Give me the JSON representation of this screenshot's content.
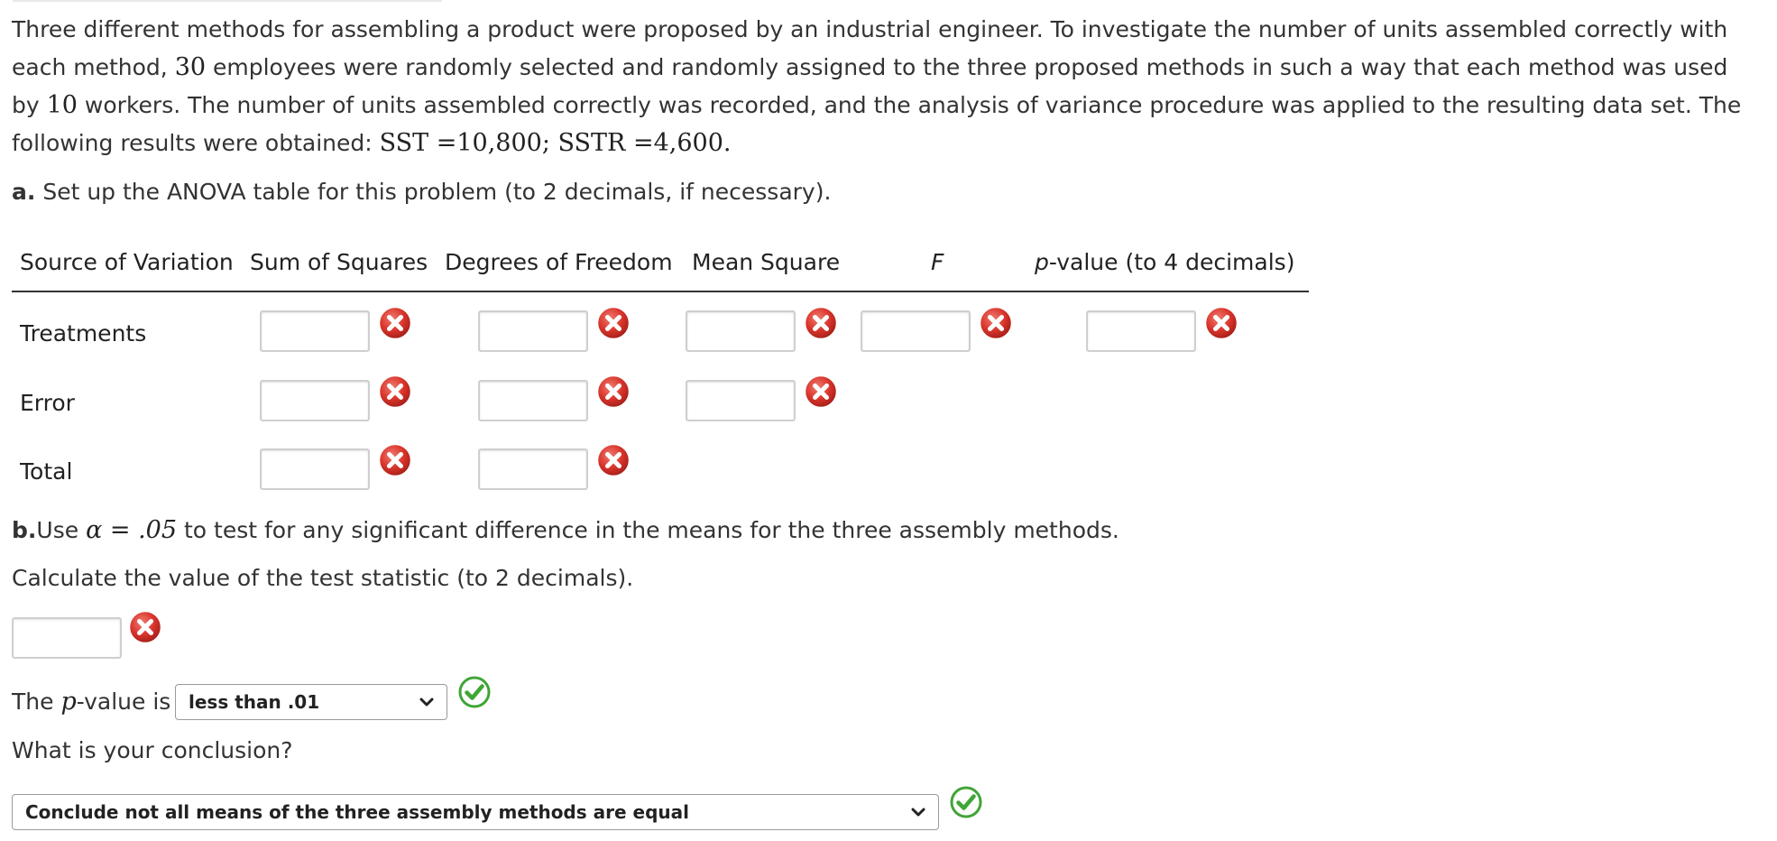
{
  "intro": {
    "p1": "Three different methods for assembling a product were proposed by an industrial engineer. To investigate the number of units assembled correctly with each method, ",
    "n_employees": "30",
    "p2": " employees were randomly selected and randomly assigned to the three proposed methods in such a way that each method was used by ",
    "n_workers": "10",
    "p3": " workers. The number of units assembled correctly was recorded, and the analysis of variance procedure was applied to the resulting data set. The following results were obtained: ",
    "sst": "SST =10,800",
    "sep": "; ",
    "sstr": "SSTR =4,600",
    "end": "."
  },
  "part_a": {
    "label": "a.",
    "text": " Set up the ANOVA table for this problem (to 2 decimals, if necessary)."
  },
  "table": {
    "headers": {
      "source": "Source of Variation",
      "ss": "Sum of Squares",
      "df": "Degrees of Freedom",
      "ms": "Mean Square",
      "f": "F",
      "p_prefix": "p",
      "p_suffix": "-value (to 4 decimals)"
    },
    "rows": {
      "treatments": "Treatments",
      "error": "Error",
      "total": "Total"
    },
    "values": {
      "treatments_ss": "",
      "treatments_df": "",
      "treatments_ms": "",
      "treatments_f": "",
      "treatments_p": "",
      "error_ss": "",
      "error_df": "",
      "error_ms": "",
      "total_ss": "",
      "total_df": ""
    }
  },
  "part_b": {
    "label": "b.",
    "text_pre": "Use ",
    "alpha_expr": "α = .05",
    "text_post": " to test for any significant difference in the means for the three assembly methods."
  },
  "calc_prompt": "Calculate the value of the test statistic (to 2 decimals).",
  "test_statistic_value": "",
  "pvalue_question": {
    "pre": "The ",
    "p": "p",
    "post": "-value is",
    "selected": "less than .01"
  },
  "conclusion": {
    "question": "What is your conclusion?",
    "selected": "Conclude not all means of the three assembly methods are equal"
  },
  "colors": {
    "incorrect_mark": "#d9342b",
    "correct_mark": "#3fa535",
    "text": "#333333"
  },
  "icons": {
    "incorrect": "incorrect-x-icon",
    "correct": "correct-check-icon",
    "dropdown": "chevron-down-icon"
  }
}
